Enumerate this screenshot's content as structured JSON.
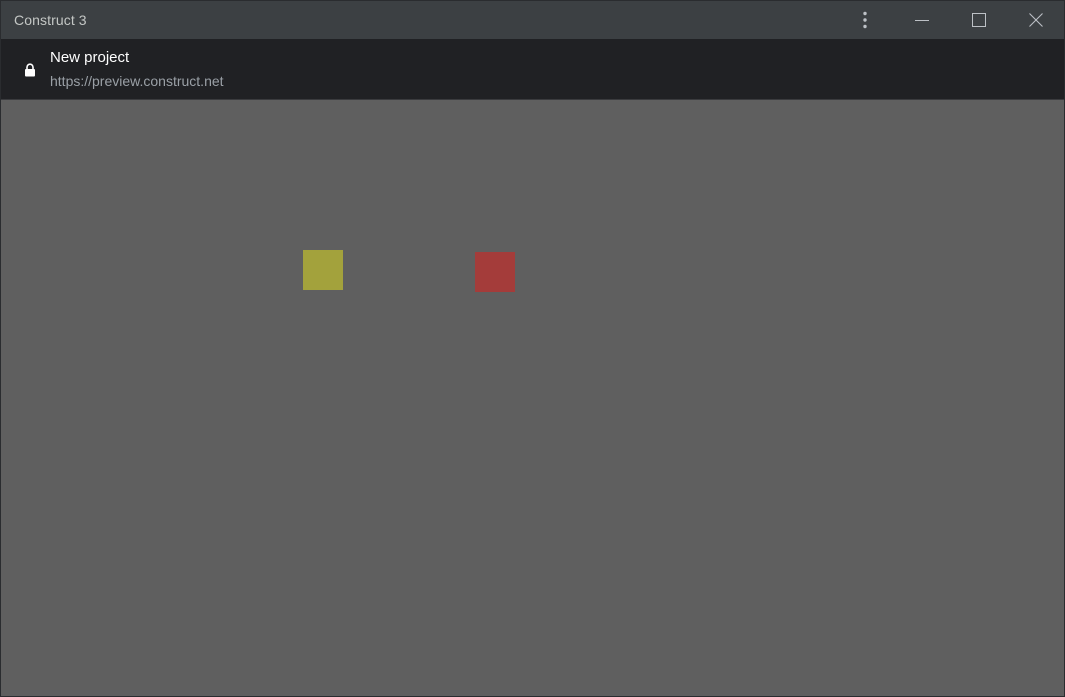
{
  "window": {
    "title": "Construct 3",
    "controls": {
      "menu_icon": "kebab-menu-icon",
      "minimize_icon": "minimize-icon",
      "maximize_icon": "maximize-icon",
      "close_icon": "close-icon"
    }
  },
  "address_bar": {
    "lock_icon": "lock-icon",
    "page_title": "New project",
    "url": "https://preview.construct.net"
  },
  "canvas": {
    "background_color": "#5f5f5f",
    "sprites": [
      {
        "name": "yellow-sprite",
        "color": "#a3a23c"
      },
      {
        "name": "red-sprite",
        "color": "#a43c3a"
      }
    ]
  }
}
